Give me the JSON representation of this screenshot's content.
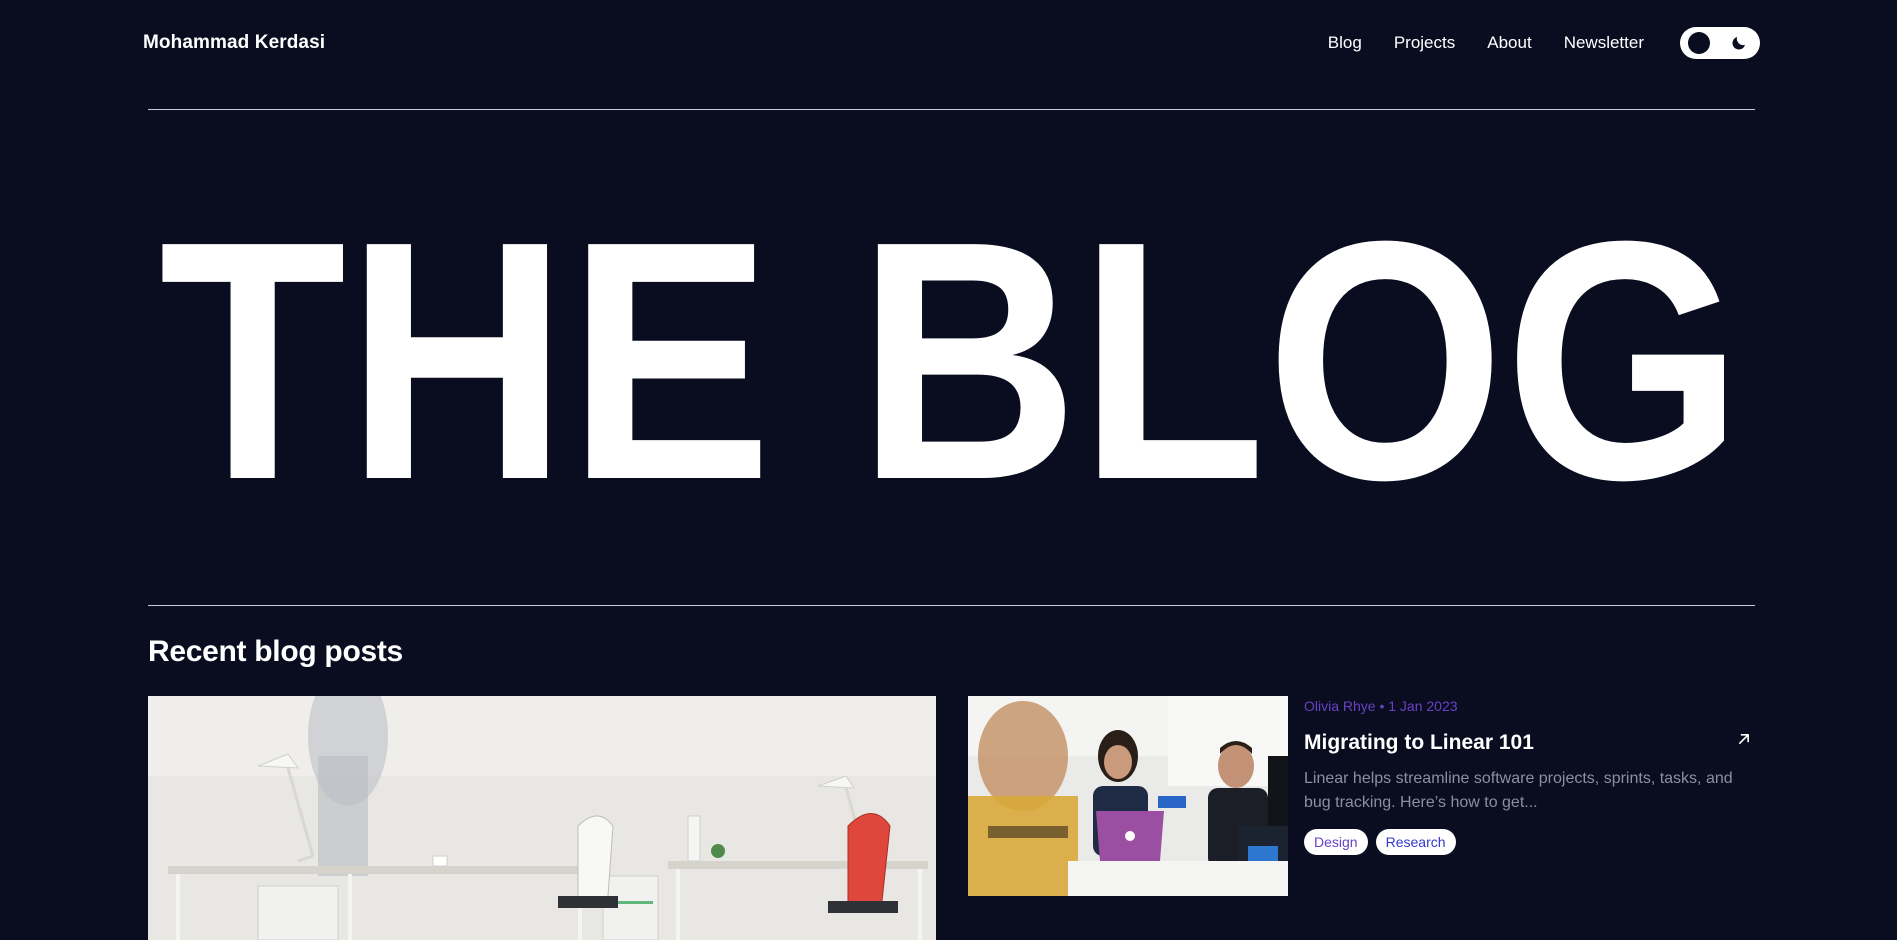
{
  "header": {
    "brand": "Mohammad Kerdasi",
    "nav": [
      "Blog",
      "Projects",
      "About",
      "Newsletter"
    ]
  },
  "hero": {
    "title": "THE BLOG"
  },
  "recent": {
    "heading": "Recent blog posts",
    "post": {
      "meta": "Olivia Rhye • 1 Jan 2023",
      "title": "Migrating to Linear 101",
      "excerpt": "Linear helps streamline software projects, sprints, tasks, and bug tracking. Here’s how to get...",
      "tags": [
        "Design",
        "Research"
      ]
    }
  },
  "colors": {
    "background": "#090d1f",
    "accent": "#6941c6",
    "text": "#ffffff",
    "muted": "#8a8fa3"
  },
  "icons": {
    "theme_toggle": [
      "sun-knob-icon",
      "moon-icon"
    ],
    "post_link": "arrow-up-right-icon"
  }
}
